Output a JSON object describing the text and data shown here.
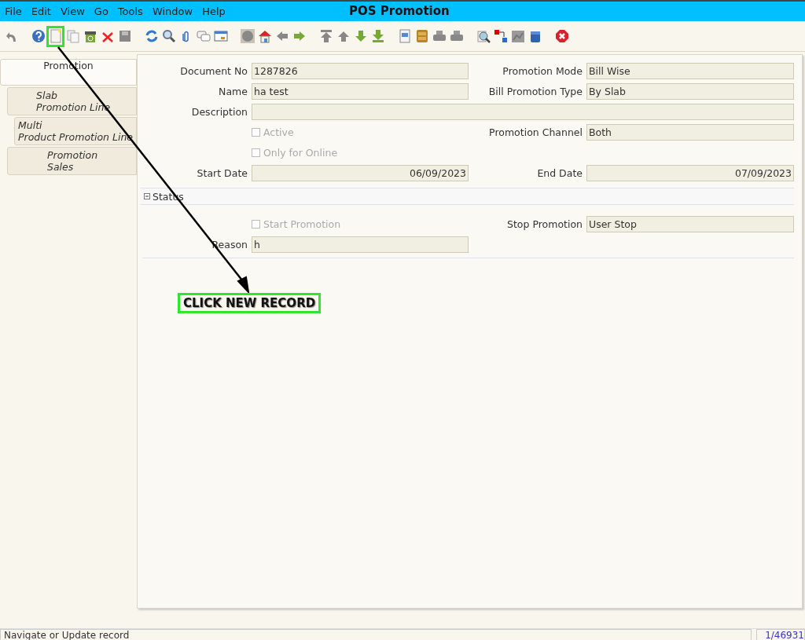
{
  "window": {
    "title": "POS Promotion"
  },
  "menu": [
    {
      "label": "File"
    },
    {
      "label": "Edit"
    },
    {
      "label": "View"
    },
    {
      "label": "Go"
    },
    {
      "label": "Tools"
    },
    {
      "label": "Window"
    },
    {
      "label": "Help"
    }
  ],
  "tabs": [
    {
      "label": "Promotion",
      "selected": true
    },
    {
      "label": "Slab\nPromotion Line",
      "selected": false
    },
    {
      "label": "Multi\nProduct Promotion Line",
      "selected": false
    },
    {
      "label": "Promotion\nSales",
      "selected": false
    }
  ],
  "form": {
    "rows": [
      [
        {
          "kind": "text",
          "label": "Document No",
          "value": "1287826"
        },
        {
          "kind": "text",
          "label": "Promotion Mode",
          "value": "Bill Wise"
        }
      ],
      [
        {
          "kind": "text",
          "label": "Name",
          "value": "ha test"
        },
        {
          "kind": "text",
          "label": "Bill Promotion Type",
          "value": "By Slab"
        }
      ],
      [
        {
          "kind": "wide",
          "label": "Description"
        }
      ],
      [
        {
          "kind": "checkbox",
          "label": "Active",
          "checked": false
        },
        {
          "kind": "text",
          "label": "Promotion Channel",
          "value": "Both"
        }
      ],
      [
        {
          "kind": "checkbox",
          "label": "Only for Online",
          "checked": false
        }
      ],
      [
        {
          "kind": "date",
          "label": "Start Date",
          "value": "06/09/2023"
        },
        {
          "kind": "date",
          "label": "End Date",
          "value": "07/09/2023"
        }
      ]
    ]
  },
  "section": {
    "title": "Status",
    "expanded": true,
    "rows": [
      [
        {
          "kind": "checkbox",
          "label": "Start Promotion",
          "checked": false
        },
        {
          "kind": "text",
          "label": "Stop Promotion",
          "value": "User Stop"
        }
      ],
      [
        {
          "kind": "text",
          "label": "Reason",
          "value": "h"
        }
      ]
    ]
  },
  "annotation": {
    "text": "CLICK NEW RECORD"
  },
  "status_bar": {
    "message": "Navigate or Update record",
    "record": "1/46931"
  }
}
